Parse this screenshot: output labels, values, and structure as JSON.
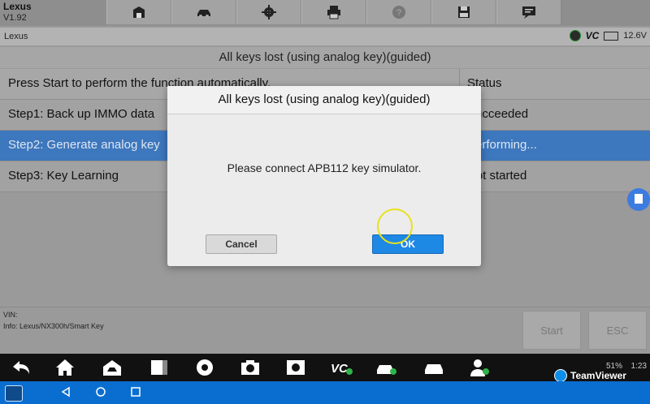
{
  "app": {
    "name": "Lexus",
    "version": "V1.92"
  },
  "toolbar": {
    "icons": [
      "home-icon",
      "vehicle-swap-icon",
      "settings-icon",
      "print-icon",
      "help-icon",
      "save-icon",
      "message-icon"
    ]
  },
  "status_strip": {
    "vehicle": "Lexus",
    "vci_label": "VC",
    "voltage": "12.6V"
  },
  "function_title": "All keys lost (using analog key)(guided)",
  "table": {
    "header": {
      "col1": "Press Start to perform the function automatically.",
      "col2": "Status"
    },
    "rows": [
      {
        "step": "Step1: Back up IMMO data",
        "status": "Succeeded"
      },
      {
        "step": "Step2: Generate analog key",
        "status": "Performing..."
      },
      {
        "step": "Step3: Key Learning",
        "status": "Not started"
      }
    ],
    "selected_index": 1
  },
  "bottom": {
    "vin_label": "VIN:",
    "info": "Info: Lexus/NX300h/Smart Key",
    "start_label": "Start",
    "esc_label": "ESC"
  },
  "dialog": {
    "title": "All keys lost (using analog key)(guided)",
    "message": "Please connect APB112 key simulator.",
    "cancel_label": "Cancel",
    "ok_label": "OK"
  },
  "system_bar": {
    "battery": "51%",
    "clock": "1:23"
  },
  "teamviewer_label": "TeamViewer",
  "colors": {
    "selected_row": "#3d77bd",
    "ok_button": "#1e88e5",
    "navbar": "#0a6ed1"
  }
}
